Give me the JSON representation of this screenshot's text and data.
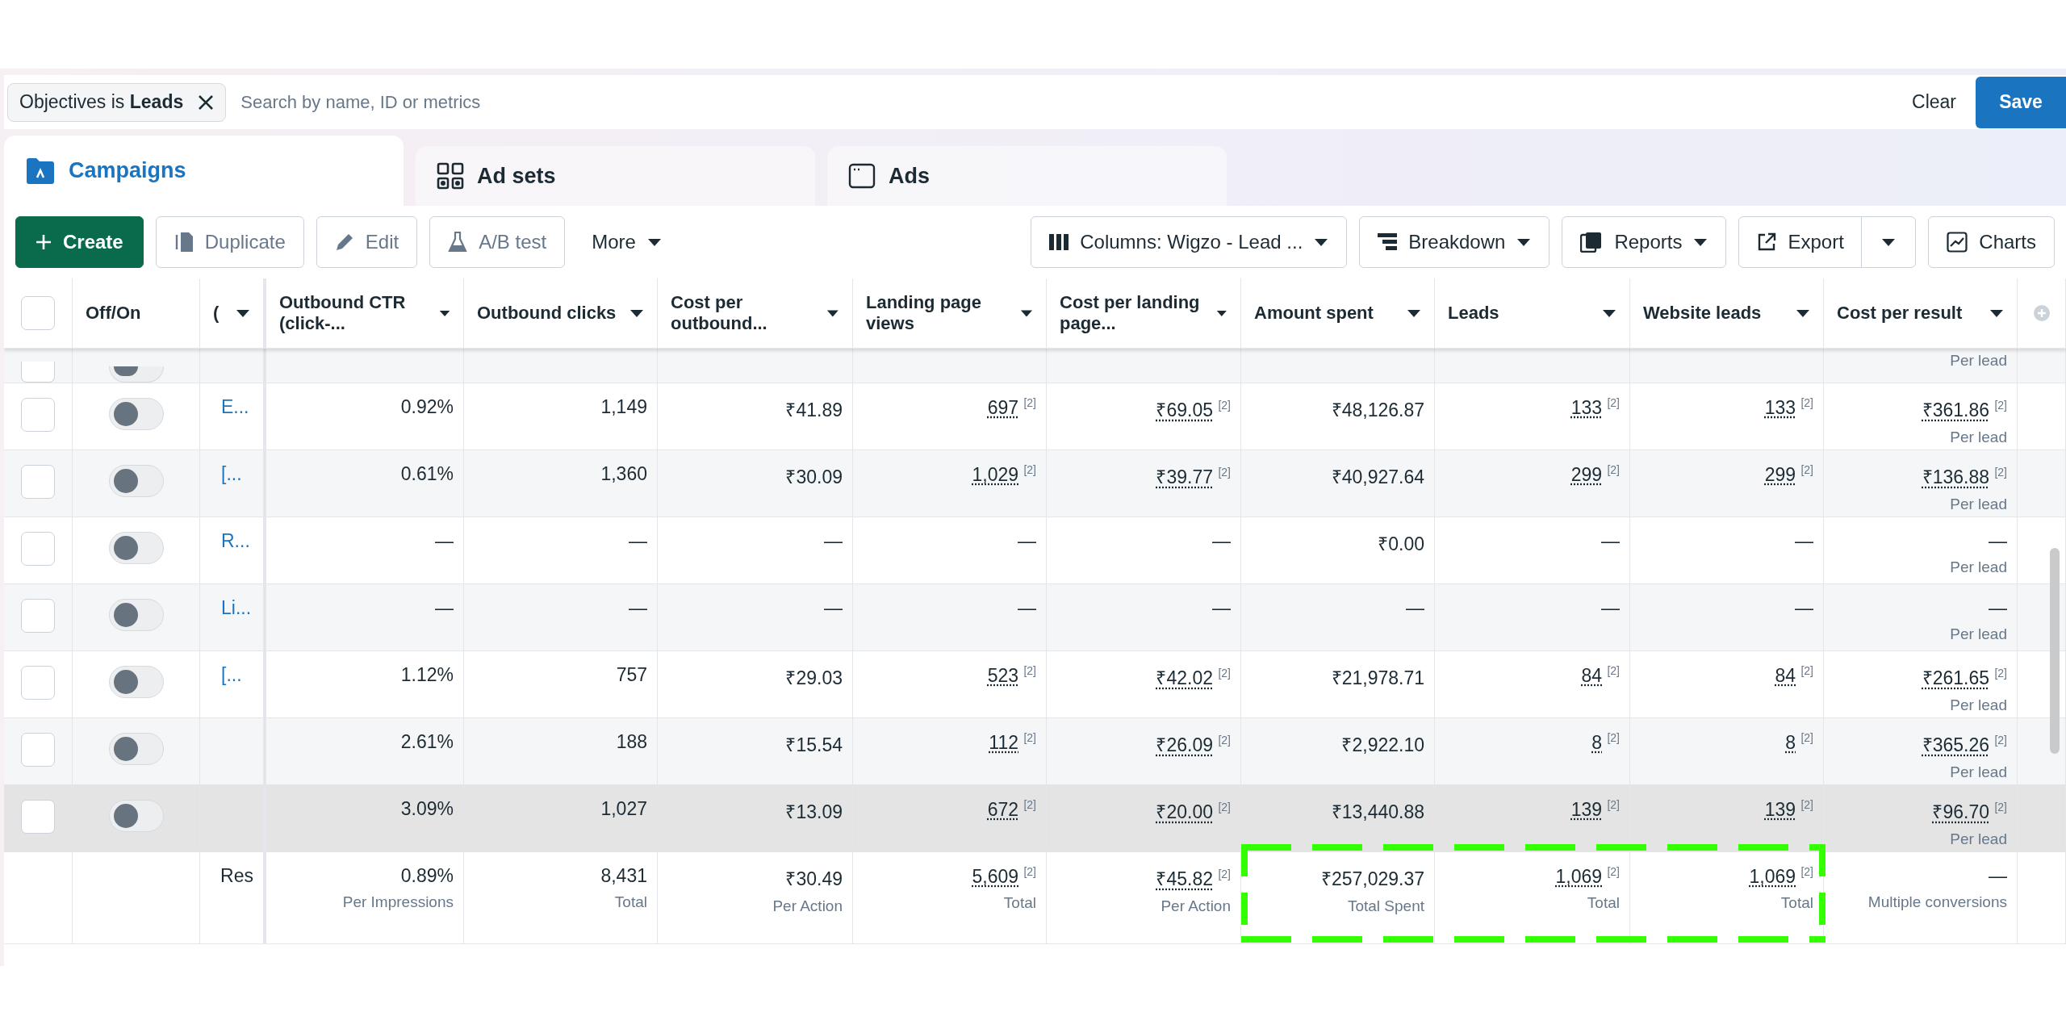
{
  "filter": {
    "chip": "Objectives is **Leads**",
    "placeholder": "Search by name, ID or metrics",
    "clear": "Clear",
    "save": "Save"
  },
  "tabs": [
    {
      "label": "Campaigns",
      "selected": true
    },
    {
      "label": "Ad sets",
      "selected": false
    },
    {
      "label": "Ads",
      "selected": false
    }
  ],
  "toolbar": [
    {
      "label": "Create",
      "kind": "primary",
      "disabled": false
    },
    {
      "label": "Duplicate",
      "kind": "outline",
      "disabled": true
    },
    {
      "label": "Edit",
      "kind": "outline",
      "disabled": true
    },
    {
      "label": "A/B test",
      "kind": "outline",
      "disabled": true
    },
    {
      "label": "More",
      "kind": "menu",
      "disabled": false
    },
    {
      "label": "Columns: Wigzo - Lead ...",
      "kind": "dropdown",
      "disabled": false
    },
    {
      "label": "Breakdown",
      "kind": "dropdown",
      "disabled": false
    },
    {
      "label": "Reports",
      "kind": "dropdown",
      "disabled": false
    },
    {
      "label": "Export",
      "kind": "split",
      "disabled": false
    },
    {
      "label": "Charts",
      "kind": "outline",
      "disabled": false
    }
  ],
  "table": {
    "select_all_checked": false,
    "columns": [
      {
        "label": "Off/On",
        "menu": false
      },
      {
        "label": "(",
        "menu": true
      },
      {
        "label": "Outbound CTR (click-...",
        "menu": true
      },
      {
        "label": "Outbound clicks",
        "menu": true
      },
      {
        "label": "Cost per outbound...",
        "menu": true
      },
      {
        "label": "Landing page views",
        "menu": true
      },
      {
        "label": "Cost per landing page...",
        "menu": true
      },
      {
        "label": "Amount spent",
        "menu": true
      },
      {
        "label": "Leads",
        "menu": true
      },
      {
        "label": "Website leads",
        "menu": true
      },
      {
        "label": "Cost per result",
        "menu": true
      }
    ],
    "rows": [
      {
        "partial": true,
        "checked": false,
        "on": false,
        "highlighted": false,
        "cells": [
          {},
          {},
          {},
          {},
          {},
          {},
          {},
          {},
          {
            "sub": "Per lead"
          }
        ]
      },
      {
        "name": "E...",
        "partial": false,
        "checked": false,
        "on": false,
        "highlighted": false,
        "cells": [
          {
            "value": "0.92%"
          },
          {
            "value": "1,149"
          },
          {
            "value": "₹41.89"
          },
          {
            "value": "697",
            "note": "[2]"
          },
          {
            "value": "₹69.05",
            "note": "[2]"
          },
          {
            "value": "₹48,126.87"
          },
          {
            "value": "133",
            "note": "[2]"
          },
          {
            "value": "133",
            "note": "[2]"
          },
          {
            "value": "₹361.86",
            "note": "[2]",
            "sub": "Per lead"
          }
        ]
      },
      {
        "name": "[...",
        "partial": false,
        "checked": false,
        "on": false,
        "highlighted": false,
        "cells": [
          {
            "value": "0.61%"
          },
          {
            "value": "1,360"
          },
          {
            "value": "₹30.09"
          },
          {
            "value": "1,029",
            "note": "[2]"
          },
          {
            "value": "₹39.77",
            "note": "[2]"
          },
          {
            "value": "₹40,927.64"
          },
          {
            "value": "299",
            "note": "[2]"
          },
          {
            "value": "299",
            "note": "[2]"
          },
          {
            "value": "₹136.88",
            "note": "[2]",
            "sub": "Per lead"
          }
        ]
      },
      {
        "name": "R...",
        "partial": false,
        "checked": false,
        "on": false,
        "highlighted": false,
        "cells": [
          {
            "value": "—"
          },
          {
            "value": "—"
          },
          {
            "value": "—"
          },
          {
            "value": "—"
          },
          {
            "value": "—"
          },
          {
            "value": "₹0.00"
          },
          {
            "value": "—"
          },
          {
            "value": "—"
          },
          {
            "value": "—",
            "sub": "Per lead"
          }
        ]
      },
      {
        "name": "Li...",
        "partial": false,
        "checked": false,
        "on": false,
        "highlighted": false,
        "cells": [
          {
            "value": "—"
          },
          {
            "value": "—"
          },
          {
            "value": "—"
          },
          {
            "value": "—"
          },
          {
            "value": "—"
          },
          {
            "value": "—"
          },
          {
            "value": "—"
          },
          {
            "value": "—"
          },
          {
            "value": "—",
            "sub": "Per lead"
          }
        ]
      },
      {
        "name": "[...",
        "partial": false,
        "checked": false,
        "on": false,
        "highlighted": false,
        "cells": [
          {
            "value": "1.12%"
          },
          {
            "value": "757"
          },
          {
            "value": "₹29.03"
          },
          {
            "value": "523",
            "note": "[2]"
          },
          {
            "value": "₹42.02",
            "note": "[2]"
          },
          {
            "value": "₹21,978.71"
          },
          {
            "value": "84",
            "note": "[2]"
          },
          {
            "value": "84",
            "note": "[2]"
          },
          {
            "value": "₹261.65",
            "note": "[2]",
            "sub": "Per lead"
          }
        ]
      },
      {
        "partial": false,
        "checked": false,
        "on": false,
        "highlighted": false,
        "cells": [
          {
            "value": "2.61%"
          },
          {
            "value": "188"
          },
          {
            "value": "₹15.54"
          },
          {
            "value": "112",
            "note": "[2]"
          },
          {
            "value": "₹26.09",
            "note": "[2]"
          },
          {
            "value": "₹2,922.10"
          },
          {
            "value": "8",
            "note": "[2]"
          },
          {
            "value": "8",
            "note": "[2]"
          },
          {
            "value": "₹365.26",
            "note": "[2]",
            "sub": "Per lead"
          }
        ]
      },
      {
        "partial": false,
        "checked": false,
        "on": false,
        "highlighted": true,
        "cells": [
          {
            "value": "3.09%"
          },
          {
            "value": "1,027"
          },
          {
            "value": "₹13.09"
          },
          {
            "value": "672",
            "note": "[2]"
          },
          {
            "value": "₹20.00",
            "note": "[2]"
          },
          {
            "value": "₹13,440.88"
          },
          {
            "value": "139",
            "note": "[2]"
          },
          {
            "value": "139",
            "note": "[2]"
          },
          {
            "value": "₹96.70",
            "note": "[2]",
            "sub": "Per lead"
          }
        ]
      }
    ],
    "footer": {
      "name": "Res",
      "cells": [
        {
          "value": "0.89%",
          "sub": "Per Impressions",
          "boxed": false
        },
        {
          "value": "8,431",
          "sub": "Total",
          "boxed": false
        },
        {
          "value": "₹30.49",
          "sub": "Per Action",
          "boxed": false
        },
        {
          "value": "5,609",
          "note": "[2]",
          "sub": "Total",
          "boxed": false
        },
        {
          "value": "₹45.82",
          "note": "[2]",
          "sub": "Per Action",
          "boxed": false
        },
        {
          "value": "₹257,029.37",
          "sub": "Total Spent",
          "boxed": true
        },
        {
          "value": "1,069",
          "note": "[2]",
          "sub": "Total",
          "boxed": true
        },
        {
          "value": "1,069",
          "note": "[2]",
          "sub": "Total",
          "boxed": true
        },
        {
          "value": "—",
          "sub": "Multiple conversions",
          "boxed": false
        }
      ]
    }
  }
}
